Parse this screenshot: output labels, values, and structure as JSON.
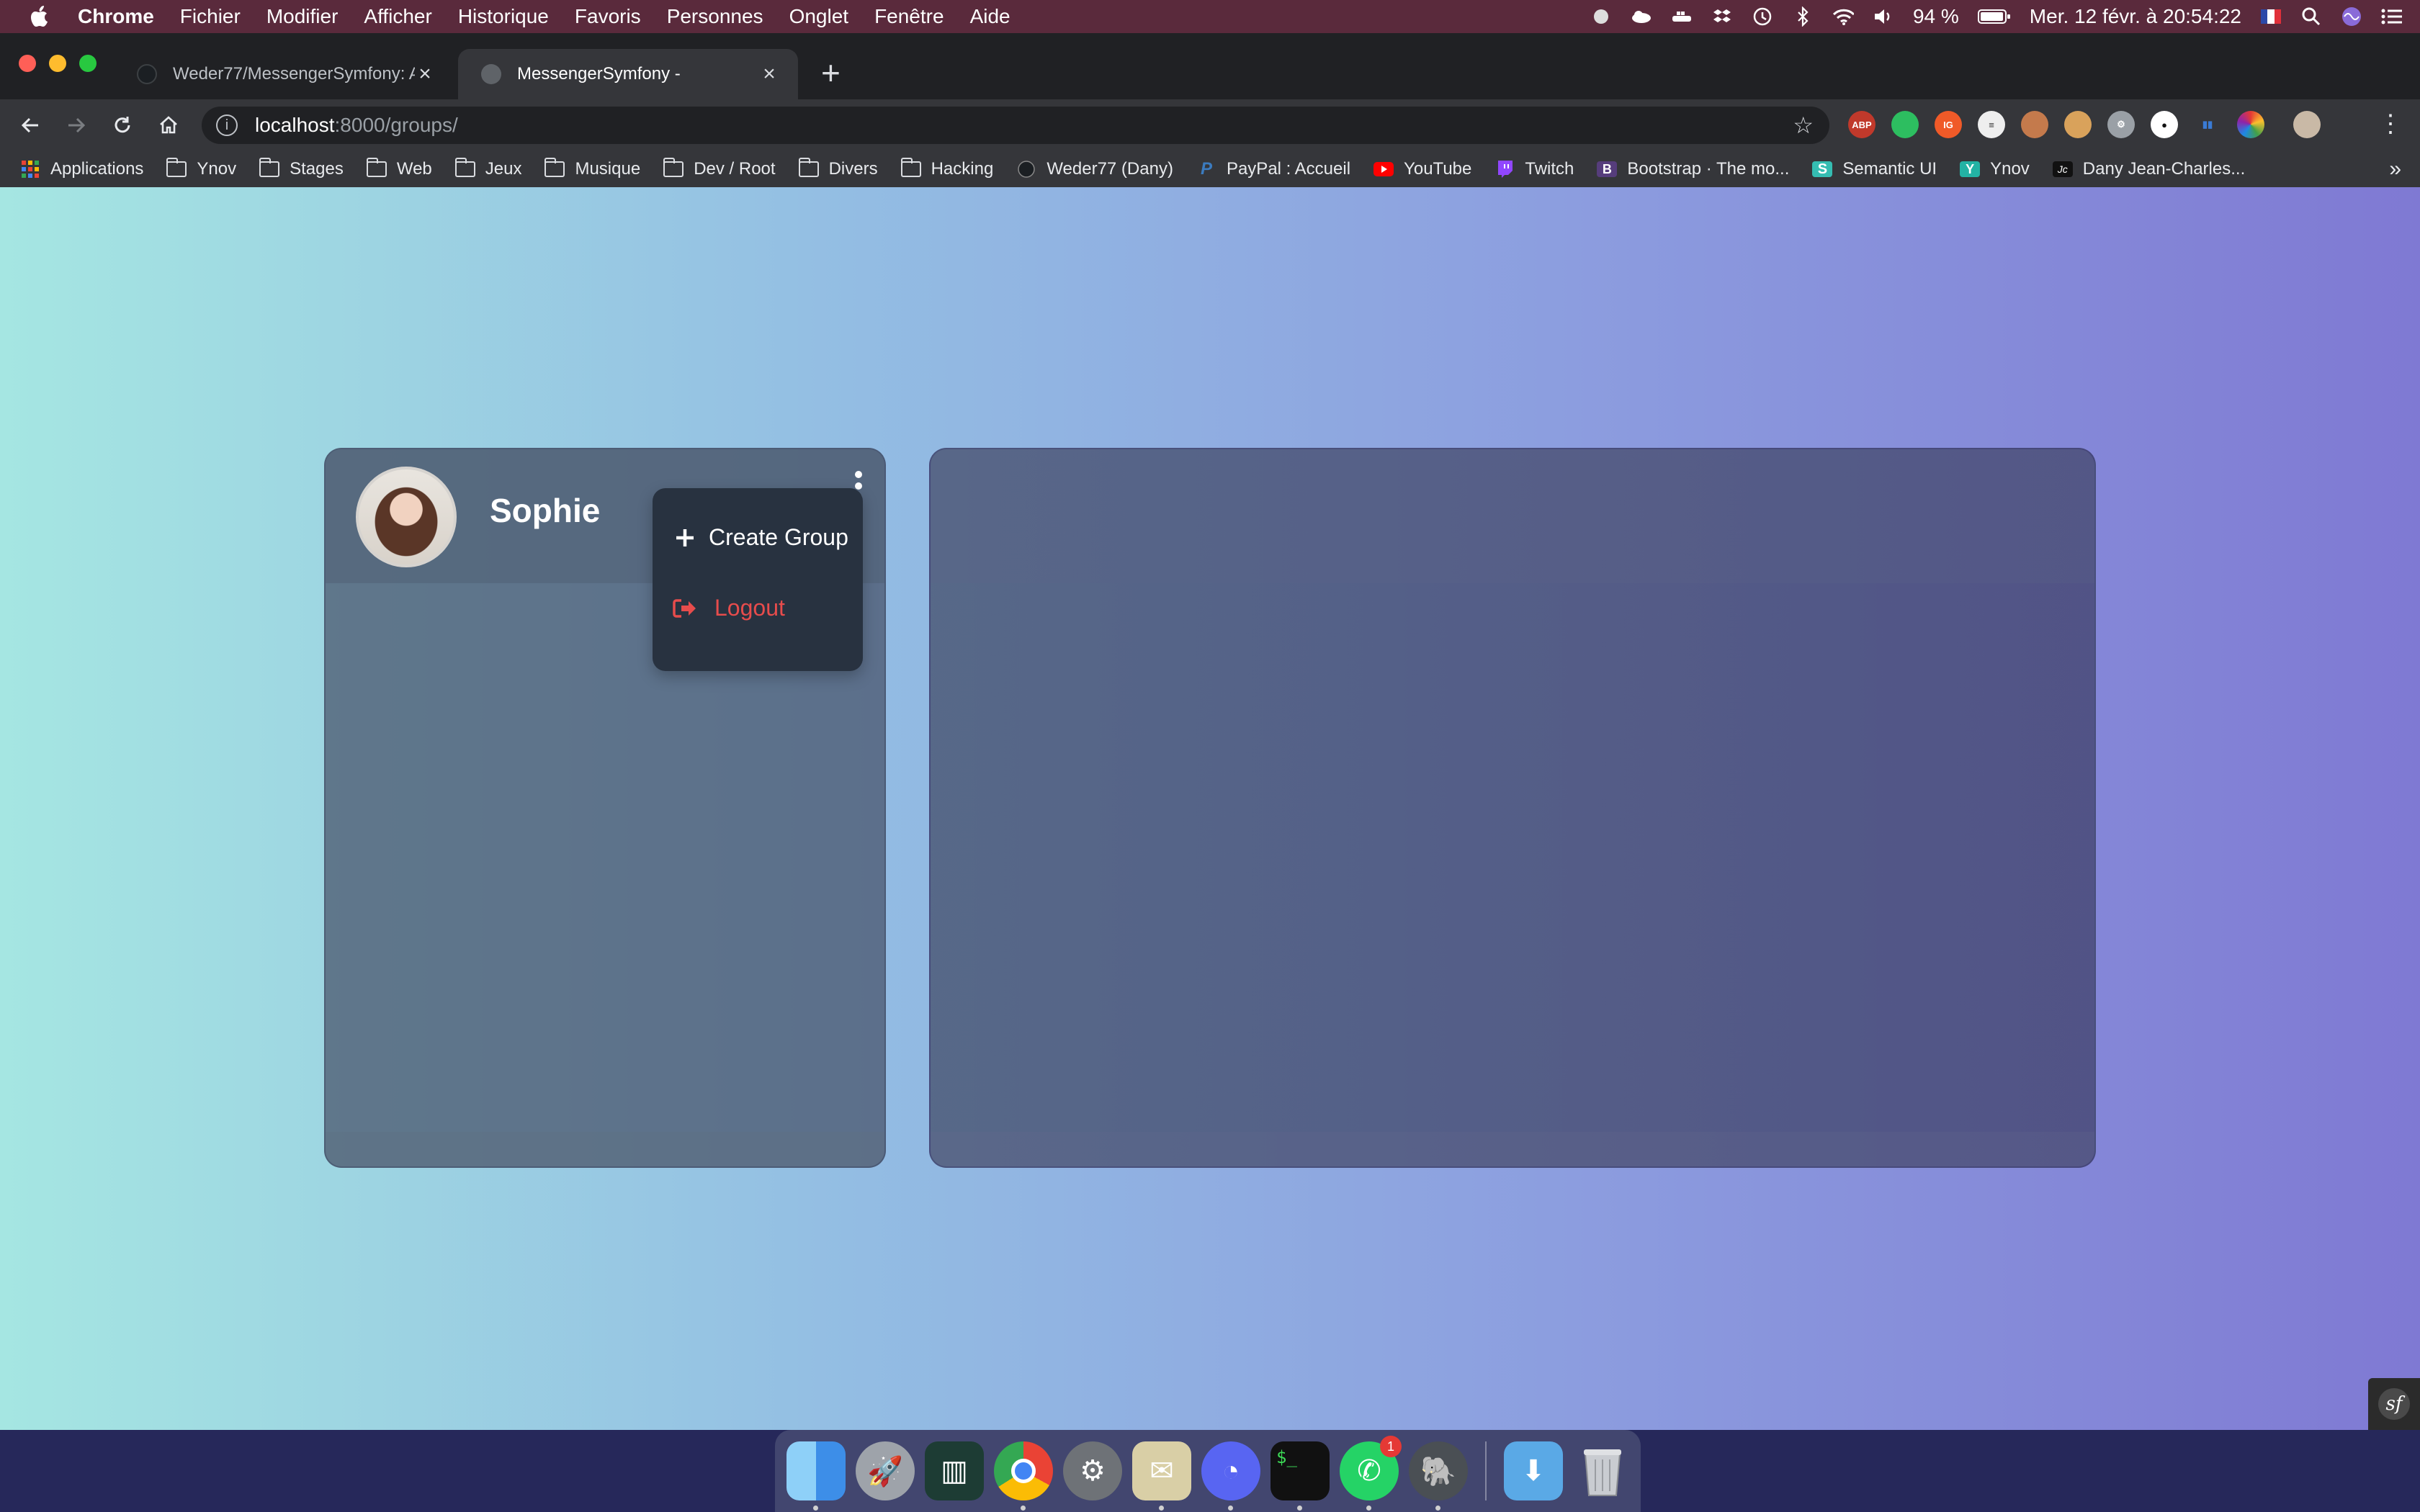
{
  "menubar": {
    "app_name": "Chrome",
    "items": [
      "Fichier",
      "Modifier",
      "Afficher",
      "Historique",
      "Favoris",
      "Personnes",
      "Onglet",
      "Fenêtre",
      "Aide"
    ],
    "battery": "94 %",
    "clock": "Mer. 12 févr. à  20:54:22"
  },
  "browser": {
    "tabs": [
      {
        "title": "Weder77/MessengerSymfony: A"
      },
      {
        "title": "MessengerSymfony -"
      }
    ],
    "url_host": "localhost",
    "url_path": ":8000/groups/",
    "bookmarks": [
      {
        "label": "Applications",
        "icon": "apps-grid-icon"
      },
      {
        "label": "Ynov",
        "icon": "folder-icon"
      },
      {
        "label": "Stages",
        "icon": "folder-icon"
      },
      {
        "label": "Web",
        "icon": "folder-icon"
      },
      {
        "label": "Jeux",
        "icon": "folder-icon"
      },
      {
        "label": "Musique",
        "icon": "folder-icon"
      },
      {
        "label": "Dev / Root",
        "icon": "folder-icon"
      },
      {
        "label": "Divers",
        "icon": "folder-icon"
      },
      {
        "label": "Hacking",
        "icon": "folder-icon"
      },
      {
        "label": "Weder77 (Dany)",
        "icon": "github-icon"
      },
      {
        "label": "PayPal : Accueil",
        "icon": "paypal-icon"
      },
      {
        "label": "YouTube",
        "icon": "youtube-icon"
      },
      {
        "label": "Twitch",
        "icon": "twitch-icon"
      },
      {
        "label": "Bootstrap · The mo...",
        "icon": "bootstrap-icon"
      },
      {
        "label": "Semantic UI",
        "icon": "semantic-ui-icon"
      },
      {
        "label": "Ynov",
        "icon": "ynov-icon"
      },
      {
        "label": "Dany Jean-Charles...",
        "icon": "jc-icon"
      }
    ],
    "bookmarks_more": "»"
  },
  "app": {
    "user_name": "Sophie",
    "menu": {
      "create_group": "Create Group",
      "logout": "Logout"
    }
  },
  "colors": {
    "logout": "#e74c4c",
    "gradient_start": "#a5e6e2",
    "gradient_end": "#7f79d3"
  },
  "dock": {
    "whatsapp_badge": "1"
  }
}
